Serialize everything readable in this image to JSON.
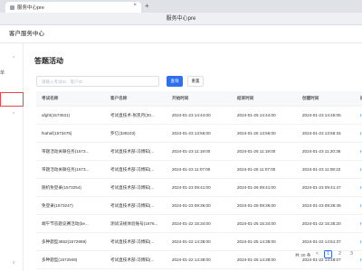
{
  "browser": {
    "tab_title": "服务中心pre",
    "tab_close": "×",
    "new_tab": "+"
  },
  "window": {
    "title": "服务中心pre"
  },
  "app": {
    "header": "客户服务中心"
  },
  "sidebar": {
    "chevron_up": "^",
    "chevron_down": "v",
    "item_text": "单"
  },
  "page": {
    "title": "答题活动",
    "search_placeholder": "请输入考试ID、客户ID",
    "query_button": "查询",
    "reset_button": "重置"
  },
  "table": {
    "columns": [
      "考试名称",
      "客户名称",
      "开始时间",
      "结束时间",
      "创建时间",
      "操"
    ],
    "rows": [
      [
        "afght(1573531)",
        "考试直技术-张凯月(30...",
        "2024-01-23 14:44:00",
        "2024-01-26 14:44:00",
        "2024-01-23 14:45:05",
        "H5"
      ],
      [
        "fsahaf(1573475)",
        "罗亿(338103)",
        "2024-01-23 13:56:00",
        "2024-01-26 13:56:00",
        "2024-01-23 13:56:34",
        "H5"
      ],
      [
        "带题活动关联任务(1573...",
        "考试直技术部-冯博知(...",
        "2024-01-23 11:19:00",
        "2024-01-26 11:19:00",
        "2024-01-23 11:20:36",
        "H5"
      ],
      [
        "带题活动关联任务(1573...",
        "考试直技术部-冯博知(...",
        "2024-01-23 11:07:00",
        "2024-01-26 11:07:00",
        "2024-01-23 11:08:22",
        "H5"
      ],
      [
        "随机免登录(1573254)",
        "考试直技术部-冯博知(...",
        "2024-01-23 09:41:00",
        "2024-01-26 09:41:00",
        "2024-01-23 09:41:47",
        "H5"
      ],
      [
        "免登录(1573247)",
        "考试直技术部-冯博知(...",
        "2024-01-23 09:36:00",
        "2024-01-26 09:36:00",
        "2024-01-23 09:36:45",
        "H5"
      ],
      [
        "端午节答题竞赛活动(be...",
        "测试法规体验账号(1676...",
        "2024-01-22 15:34:00",
        "2024-01-25 15:34:00",
        "2024-01-22 15:35:20",
        "H5"
      ],
      [
        "多种题型3652(1572969)",
        "考试直技术部-冯博知(...",
        "2024-01-22 14:38:00",
        "2024-01-25 14:38:00",
        "2024-01-22 14:51:37",
        "H5"
      ],
      [
        "多种题型(1572949)",
        "考试直技术部-冯博知(...",
        "2024-01-22 14:38:00",
        "2024-01-25 14:38:00",
        "2024-01-22 14:48:07",
        "H5"
      ]
    ]
  },
  "pagination": {
    "total": "共 30 条",
    "prev": "<",
    "pages": [
      "1",
      "2",
      "3"
    ]
  }
}
